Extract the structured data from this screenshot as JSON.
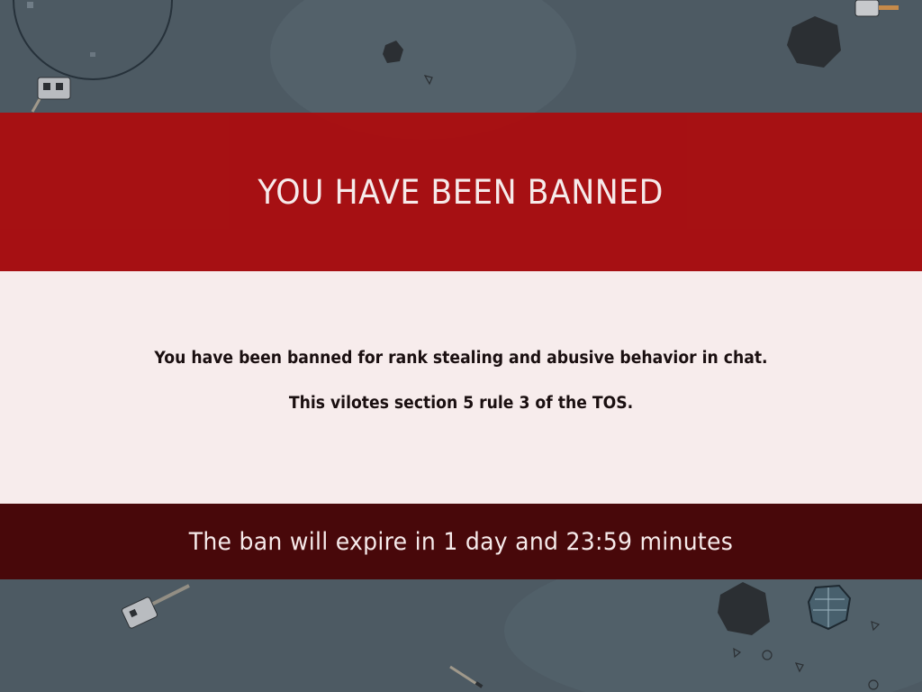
{
  "ban_screen": {
    "title": "YOU HAVE BEEN BANNED",
    "reason": "You have been banned for rank stealing and abusive behavior in chat.",
    "rule_reference": "This vilotes section 5 rule 3 of the TOS.",
    "expiry": "The ban will expire in 1 day and 23:59 minutes"
  },
  "colors": {
    "title_band": "#ac0c0e",
    "message_band": "#f7ecec",
    "expiry_band": "#480608",
    "game_background": "#4d5962"
  }
}
